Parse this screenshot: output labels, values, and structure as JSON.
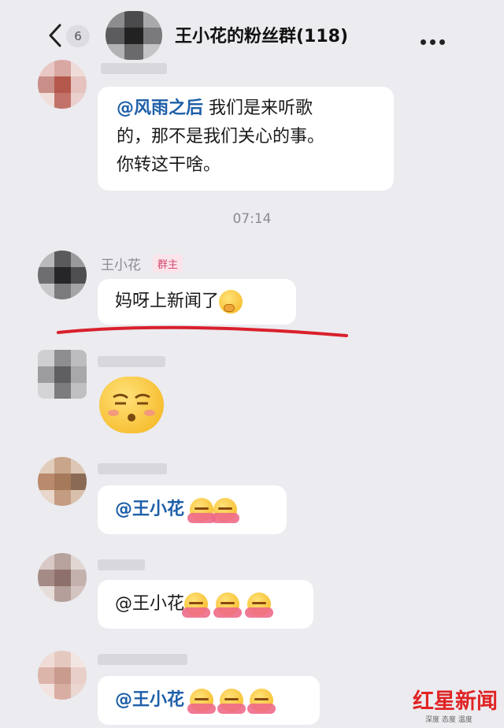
{
  "header": {
    "unread_count": "6",
    "title": "王小花的粉丝群(118)"
  },
  "messages": [
    {
      "mention": "@风雨之后",
      "line1": " 我们是来听歌",
      "line2": "的，那不是我们关心的事。",
      "line3": "你转这干啥。"
    },
    {
      "sender": "王小花",
      "role": "群主",
      "text": "妈呀上新闻了"
    },
    {
      "mention": "@王小花"
    },
    {
      "mention": "@王小花"
    },
    {
      "mention": "@王小花"
    }
  ],
  "time_divider": "07:14",
  "watermark": {
    "brand": "红星新闻",
    "sub": "深度 态度 温度"
  },
  "colors": {
    "background": "#ebebf0",
    "mention": "#1e5fa8",
    "underline": "#d9202c"
  }
}
